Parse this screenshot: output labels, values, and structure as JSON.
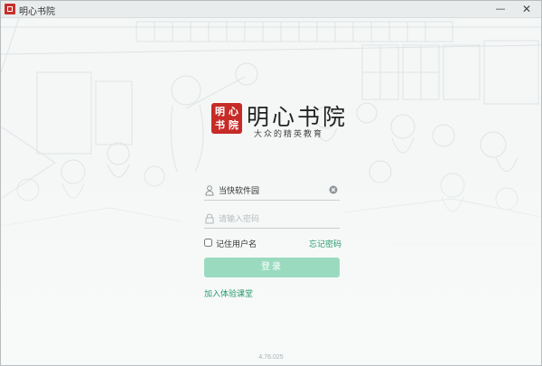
{
  "window": {
    "title": "明心书院",
    "minimize_glyph": "—",
    "close_glyph": "✕"
  },
  "brand": {
    "seal_text": "明心书院",
    "name": "明心书院",
    "slogan": "大众的精英教育",
    "seal_color": "#c62b27"
  },
  "login": {
    "username_value": "当快软件园",
    "username_icon": "user-icon",
    "clear_icon": "clear-circle-icon",
    "password_placeholder": "请输入密码",
    "password_icon": "lock-icon",
    "remember_label": "记住用户名",
    "remember_checked": false,
    "forgot_label": "忘记密码",
    "submit_label": "登录",
    "trial_label": "加入体验课堂",
    "accent_color": "#2a9a6e",
    "button_color": "#9adbc0"
  },
  "footer": {
    "version": "4.76.025"
  }
}
